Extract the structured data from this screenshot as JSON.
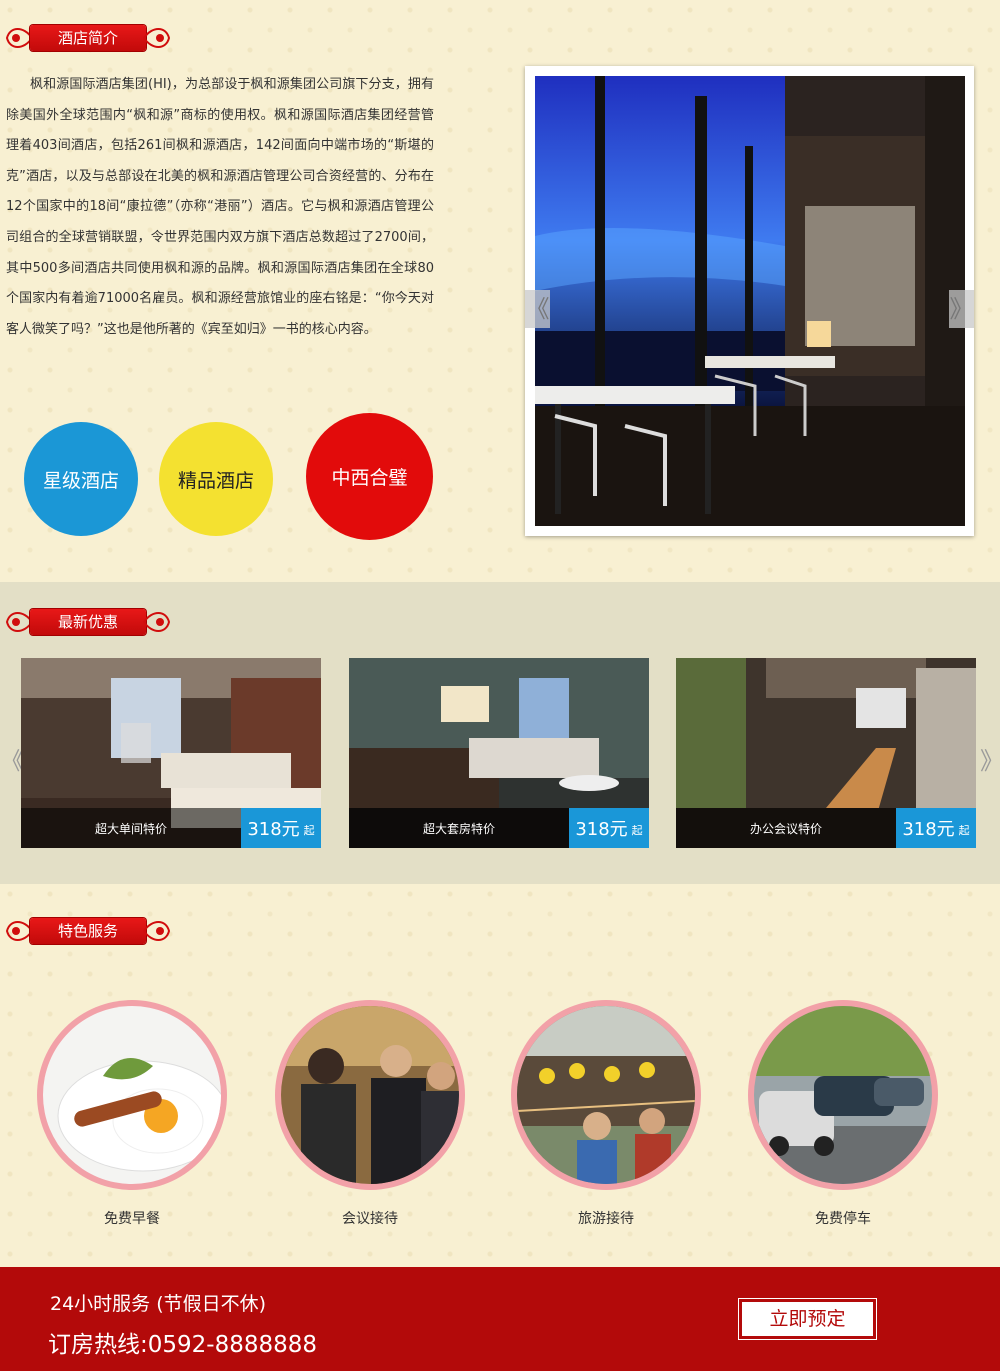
{
  "intro": {
    "title": "酒店简介",
    "paragraph": "枫和源国际酒店集团(HI)，为总部设于枫和源集团公司旗下分支，拥有除美国外全球范围内“枫和源”商标的使用权。枫和源国际酒店集团经营管理着403间酒店，包括261间枫和源酒店，142间面向中端市场的“斯堪的克”酒店，以及与总部设在北美的枫和源酒店管理公司合资经营的、分布在12个国家中的18间“康拉德”（亦称“港丽”）酒店。它与枫和源酒店管理公司组合的全球营销联盟，令世界范围内双方旗下酒店总数超过了2700间，其中500多间酒店共同使用枫和源的品牌。枫和源国际酒店集团在全球80个国家内有着逾71000名雇员。枫和源经营旅馆业的座右铭是：“你今天对客人微笑了吗？”这也是他所著的《宾至如归》一书的核心内容。",
    "circles": [
      "星级酒店",
      "精品酒店",
      "中西合璧"
    ],
    "colors": {
      "blue": "#1b97d6",
      "yellow": "#f4e130",
      "red": "#e20b0b"
    }
  },
  "offers": {
    "title": "最新优惠",
    "items": [
      {
        "label": "超大单间特价",
        "price": "318元",
        "unit": "起"
      },
      {
        "label": "超大套房特价",
        "price": "318元",
        "unit": "起"
      },
      {
        "label": "办公会议特价",
        "price": "318元",
        "unit": "起"
      }
    ],
    "arrow_left": "《",
    "arrow_right": "》",
    "price_color": "#1a97d8"
  },
  "services": {
    "title": "特色服务",
    "items": [
      {
        "label": "免费早餐",
        "icon": "breakfast-photo"
      },
      {
        "label": "会议接待",
        "icon": "meeting-photo"
      },
      {
        "label": "旅游接待",
        "icon": "tour-photo"
      },
      {
        "label": "免费停车",
        "icon": "parking-photo"
      }
    ]
  },
  "footer": {
    "line1": "24小时服务 (节假日不休)",
    "line2": "订房热线:0592-8888888",
    "book_label": "立即预定",
    "bg_color": "#b30a0a"
  },
  "hero": {
    "arrow_left": "《",
    "arrow_right": "》"
  }
}
